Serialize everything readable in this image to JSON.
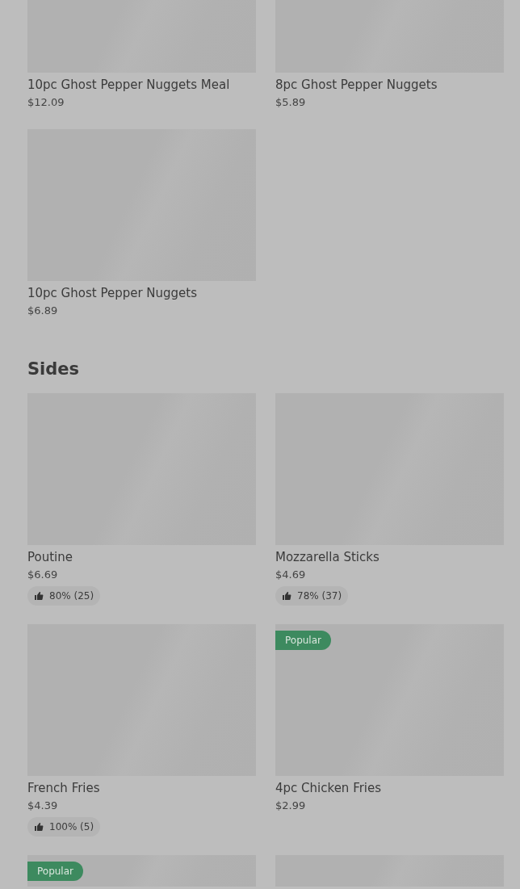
{
  "sections": [
    {
      "rows": [
        {
          "items": [
            {
              "kind": "item",
              "name": "10pc Ghost Pepper Nuggets Meal",
              "price": "$12.09"
            },
            {
              "kind": "item",
              "name": "8pc Ghost Pepper Nuggets",
              "price": "$5.89"
            }
          ]
        },
        {
          "items": [
            {
              "kind": "item",
              "name": "10pc Ghost Pepper Nuggets",
              "price": "$6.89"
            }
          ]
        }
      ]
    },
    {
      "title": "Sides",
      "rows": [
        {
          "items": [
            {
              "kind": "item",
              "name": "Poutine",
              "price": "$6.69",
              "rating": "80% (25)"
            },
            {
              "kind": "item",
              "name": "Mozzarella Sticks",
              "price": "$4.69",
              "rating": "78% (37)"
            }
          ]
        },
        {
          "items": [
            {
              "kind": "item",
              "name": "French Fries",
              "price": "$4.39",
              "rating": "100% (5)"
            },
            {
              "kind": "item",
              "badge": "Popular",
              "name": "4pc Chicken Fries",
              "price": "$2.99"
            }
          ]
        },
        {
          "items": [
            {
              "kind": "item",
              "badge": "Popular"
            },
            {
              "kind": "item"
            }
          ]
        }
      ]
    }
  ]
}
